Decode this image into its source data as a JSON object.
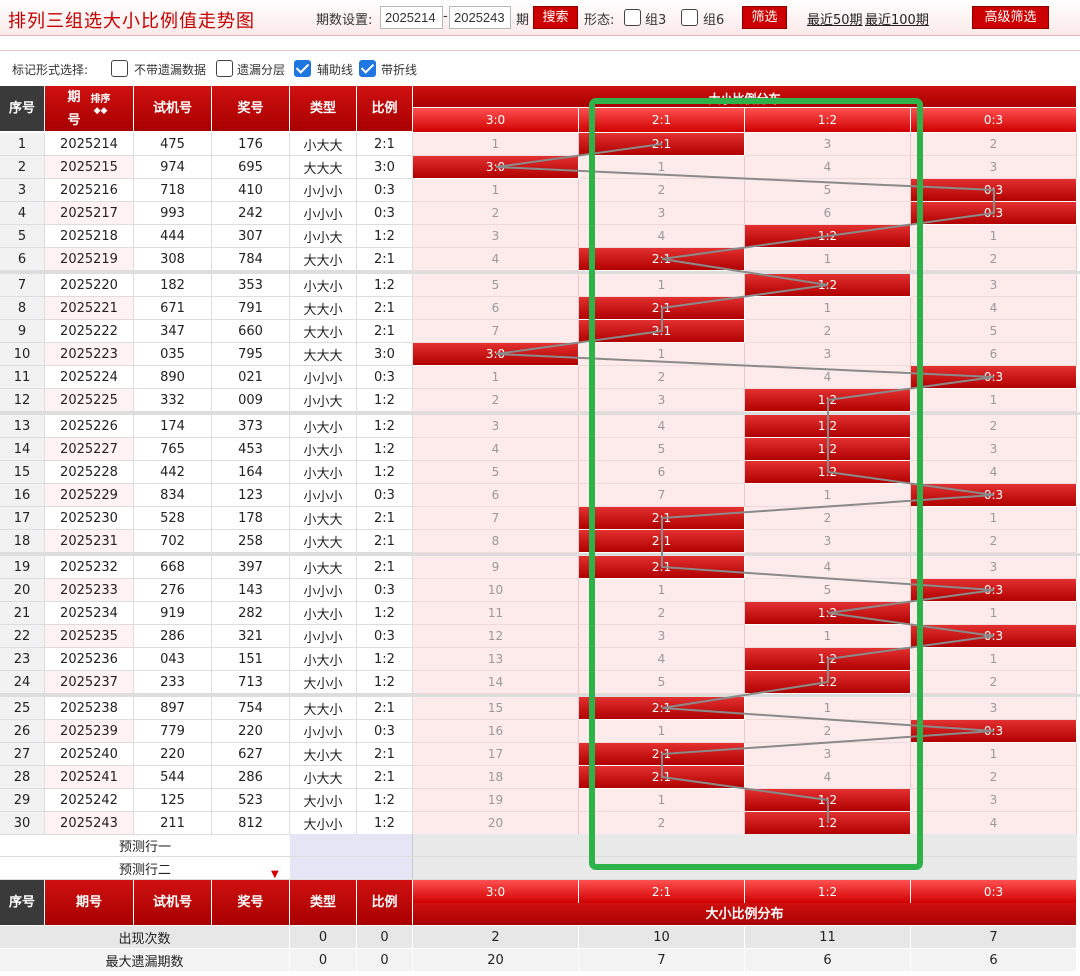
{
  "app_title": "排列三组选大小比例值走势图",
  "toolbar": {
    "period_label": "期数设置:",
    "from_value": "2025214",
    "dash": "-",
    "to_value": "2025243",
    "period_suffix": "期",
    "search_label": "搜索",
    "shape_label": "形态:",
    "group3_label": "组3",
    "group6_label": "组6",
    "filter_label": "筛选",
    "recent50_label": "最近50期",
    "recent100_label": "最近100期",
    "advanced_label": "高级筛选"
  },
  "options": {
    "label": "标记形式选择:",
    "items": [
      {
        "label": "不带遗漏数据",
        "checked": false
      },
      {
        "label": "遗漏分层",
        "checked": false
      },
      {
        "label": "辅助线",
        "checked": true
      },
      {
        "label": "带折线",
        "checked": true
      }
    ]
  },
  "header": {
    "seq": "序号",
    "issue_top": "期",
    "issue_bottom": "号",
    "sort": "排序",
    "trial": "试机号",
    "prize": "奖号",
    "type": "类型",
    "ratio": "比例",
    "group_title": "大小比例分布",
    "ratio_cols": [
      "3:0",
      "2:1",
      "1:2",
      "0:3"
    ]
  },
  "rows": [
    {
      "seq": "1",
      "issue": "2025214",
      "trial": "475",
      "prize": "176",
      "type": "小大大",
      "ratio": "2:1",
      "dist": [
        "1",
        "2:1",
        "3",
        "2"
      ],
      "hit": 1
    },
    {
      "seq": "2",
      "issue": "2025215",
      "trial": "974",
      "prize": "695",
      "type": "大大大",
      "ratio": "3:0",
      "dist": [
        "3:0",
        "1",
        "4",
        "3"
      ],
      "hit": 0
    },
    {
      "seq": "3",
      "issue": "2025216",
      "trial": "718",
      "prize": "410",
      "type": "小小小",
      "ratio": "0:3",
      "dist": [
        "1",
        "2",
        "5",
        "0:3"
      ],
      "hit": 3
    },
    {
      "seq": "4",
      "issue": "2025217",
      "trial": "993",
      "prize": "242",
      "type": "小小小",
      "ratio": "0:3",
      "dist": [
        "2",
        "3",
        "6",
        "0:3"
      ],
      "hit": 3
    },
    {
      "seq": "5",
      "issue": "2025218",
      "trial": "444",
      "prize": "307",
      "type": "小小大",
      "ratio": "1:2",
      "dist": [
        "3",
        "4",
        "1:2",
        "1"
      ],
      "hit": 2
    },
    {
      "seq": "6",
      "issue": "2025219",
      "trial": "308",
      "prize": "784",
      "type": "大大小",
      "ratio": "2:1",
      "dist": [
        "4",
        "2:1",
        "1",
        "2"
      ],
      "hit": 1
    },
    {
      "seq": "7",
      "issue": "2025220",
      "trial": "182",
      "prize": "353",
      "type": "小大小",
      "ratio": "1:2",
      "dist": [
        "5",
        "1",
        "1:2",
        "3"
      ],
      "hit": 2
    },
    {
      "seq": "8",
      "issue": "2025221",
      "trial": "671",
      "prize": "791",
      "type": "大大小",
      "ratio": "2:1",
      "dist": [
        "6",
        "2:1",
        "1",
        "4"
      ],
      "hit": 1
    },
    {
      "seq": "9",
      "issue": "2025222",
      "trial": "347",
      "prize": "660",
      "type": "大大小",
      "ratio": "2:1",
      "dist": [
        "7",
        "2:1",
        "2",
        "5"
      ],
      "hit": 1
    },
    {
      "seq": "10",
      "issue": "2025223",
      "trial": "035",
      "prize": "795",
      "type": "大大大",
      "ratio": "3:0",
      "dist": [
        "3:0",
        "1",
        "3",
        "6"
      ],
      "hit": 0
    },
    {
      "seq": "11",
      "issue": "2025224",
      "trial": "890",
      "prize": "021",
      "type": "小小小",
      "ratio": "0:3",
      "dist": [
        "1",
        "2",
        "4",
        "0:3"
      ],
      "hit": 3
    },
    {
      "seq": "12",
      "issue": "2025225",
      "trial": "332",
      "prize": "009",
      "type": "小小大",
      "ratio": "1:2",
      "dist": [
        "2",
        "3",
        "1:2",
        "1"
      ],
      "hit": 2
    },
    {
      "seq": "13",
      "issue": "2025226",
      "trial": "174",
      "prize": "373",
      "type": "小大小",
      "ratio": "1:2",
      "dist": [
        "3",
        "4",
        "1:2",
        "2"
      ],
      "hit": 2
    },
    {
      "seq": "14",
      "issue": "2025227",
      "trial": "765",
      "prize": "453",
      "type": "小大小",
      "ratio": "1:2",
      "dist": [
        "4",
        "5",
        "1:2",
        "3"
      ],
      "hit": 2
    },
    {
      "seq": "15",
      "issue": "2025228",
      "trial": "442",
      "prize": "164",
      "type": "小大小",
      "ratio": "1:2",
      "dist": [
        "5",
        "6",
        "1:2",
        "4"
      ],
      "hit": 2
    },
    {
      "seq": "16",
      "issue": "2025229",
      "trial": "834",
      "prize": "123",
      "type": "小小小",
      "ratio": "0:3",
      "dist": [
        "6",
        "7",
        "1",
        "0:3"
      ],
      "hit": 3
    },
    {
      "seq": "17",
      "issue": "2025230",
      "trial": "528",
      "prize": "178",
      "type": "小大大",
      "ratio": "2:1",
      "dist": [
        "7",
        "2:1",
        "2",
        "1"
      ],
      "hit": 1
    },
    {
      "seq": "18",
      "issue": "2025231",
      "trial": "702",
      "prize": "258",
      "type": "小大大",
      "ratio": "2:1",
      "dist": [
        "8",
        "2:1",
        "3",
        "2"
      ],
      "hit": 1
    },
    {
      "seq": "19",
      "issue": "2025232",
      "trial": "668",
      "prize": "397",
      "type": "小大大",
      "ratio": "2:1",
      "dist": [
        "9",
        "2:1",
        "4",
        "3"
      ],
      "hit": 1
    },
    {
      "seq": "20",
      "issue": "2025233",
      "trial": "276",
      "prize": "143",
      "type": "小小小",
      "ratio": "0:3",
      "dist": [
        "10",
        "1",
        "5",
        "0:3"
      ],
      "hit": 3
    },
    {
      "seq": "21",
      "issue": "2025234",
      "trial": "919",
      "prize": "282",
      "type": "小大小",
      "ratio": "1:2",
      "dist": [
        "11",
        "2",
        "1:2",
        "1"
      ],
      "hit": 2
    },
    {
      "seq": "22",
      "issue": "2025235",
      "trial": "286",
      "prize": "321",
      "type": "小小小",
      "ratio": "0:3",
      "dist": [
        "12",
        "3",
        "1",
        "0:3"
      ],
      "hit": 3
    },
    {
      "seq": "23",
      "issue": "2025236",
      "trial": "043",
      "prize": "151",
      "type": "小大小",
      "ratio": "1:2",
      "dist": [
        "13",
        "4",
        "1:2",
        "1"
      ],
      "hit": 2
    },
    {
      "seq": "24",
      "issue": "2025237",
      "trial": "233",
      "prize": "713",
      "type": "大小小",
      "ratio": "1:2",
      "dist": [
        "14",
        "5",
        "1:2",
        "2"
      ],
      "hit": 2
    },
    {
      "seq": "25",
      "issue": "2025238",
      "trial": "897",
      "prize": "754",
      "type": "大大小",
      "ratio": "2:1",
      "dist": [
        "15",
        "2:1",
        "1",
        "3"
      ],
      "hit": 1
    },
    {
      "seq": "26",
      "issue": "2025239",
      "trial": "779",
      "prize": "220",
      "type": "小小小",
      "ratio": "0:3",
      "dist": [
        "16",
        "1",
        "2",
        "0:3"
      ],
      "hit": 3
    },
    {
      "seq": "27",
      "issue": "2025240",
      "trial": "220",
      "prize": "627",
      "type": "大小大",
      "ratio": "2:1",
      "dist": [
        "17",
        "2:1",
        "3",
        "1"
      ],
      "hit": 1
    },
    {
      "seq": "28",
      "issue": "2025241",
      "trial": "544",
      "prize": "286",
      "type": "小大大",
      "ratio": "2:1",
      "dist": [
        "18",
        "2:1",
        "4",
        "2"
      ],
      "hit": 1
    },
    {
      "seq": "29",
      "issue": "2025242",
      "trial": "125",
      "prize": "523",
      "type": "大小小",
      "ratio": "1:2",
      "dist": [
        "19",
        "1",
        "1:2",
        "3"
      ],
      "hit": 2
    },
    {
      "seq": "30",
      "issue": "2025243",
      "trial": "211",
      "prize": "812",
      "type": "大小小",
      "ratio": "1:2",
      "dist": [
        "20",
        "2",
        "1:2",
        "4"
      ],
      "hit": 2
    }
  ],
  "predict": {
    "row1": "预测行一",
    "row2": "预测行二"
  },
  "stats": [
    {
      "label": "出现次数",
      "type": "0",
      "ratio": "0",
      "values": [
        "2",
        "10",
        "11",
        "7"
      ]
    },
    {
      "label": "最大遗漏期数",
      "type": "0",
      "ratio": "0",
      "values": [
        "20",
        "7",
        "6",
        "6"
      ]
    }
  ],
  "colors": {
    "brand_red": "#cc0000",
    "highlight_green": "#2db34a",
    "trend_line": "#8a8a8a"
  },
  "icons": {
    "sort": "sort-arrows-icon",
    "down_arrow": "down-arrow-icon"
  }
}
